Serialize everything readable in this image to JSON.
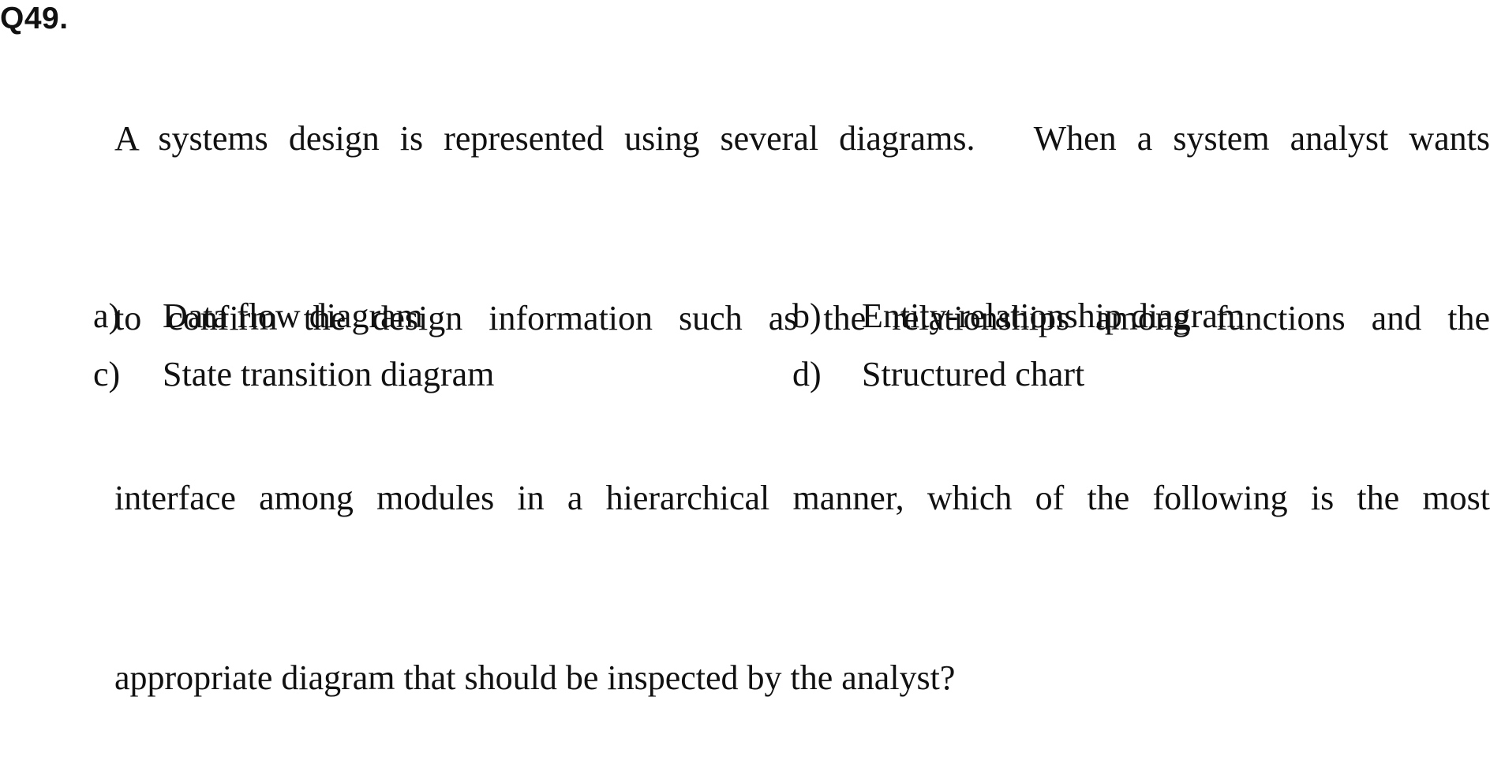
{
  "question": {
    "number": "Q49.",
    "lines": [
      "A systems design is represented using several diagrams.　When a system analyst wants",
      "to confirm the design information such as the relationships among functions and the",
      "interface among modules in a hierarchical manner, which of the following is the most",
      "appropriate diagram that should be inspected by the analyst?"
    ]
  },
  "choices": [
    {
      "letter": "a)",
      "text": "Data flow diagram"
    },
    {
      "letter": "b)",
      "text": "Entity-relationship diagram"
    },
    {
      "letter": "c)",
      "text": "State transition diagram"
    },
    {
      "letter": "d)",
      "text": "Structured chart"
    }
  ]
}
